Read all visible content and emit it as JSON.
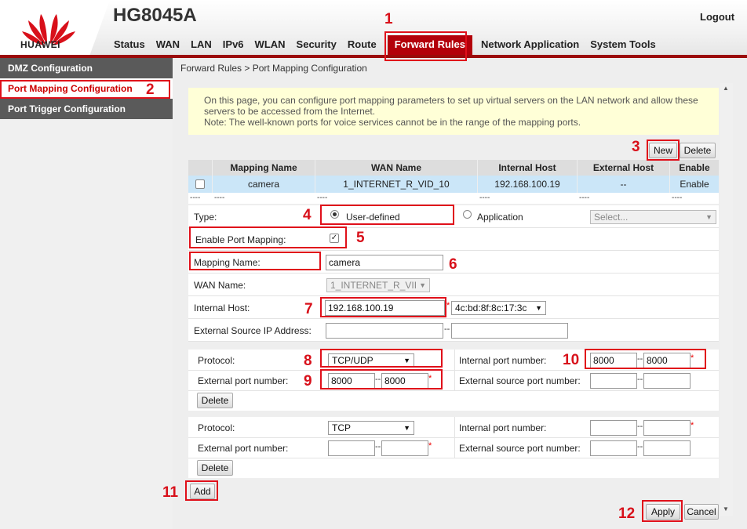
{
  "header": {
    "brand": "HUAWEI",
    "model": "HG8045A",
    "logout": "Logout",
    "nav": [
      "Status",
      "WAN",
      "LAN",
      "IPv6",
      "WLAN",
      "Security",
      "Route",
      "Forward Rules",
      "Network Application",
      "System Tools"
    ],
    "active_nav": "Forward Rules"
  },
  "sidebar": {
    "items": [
      "DMZ Configuration",
      "Port Mapping Configuration",
      "Port Trigger Configuration"
    ],
    "active": "Port Mapping Configuration"
  },
  "breadcrumb": "Forward Rules > Port Mapping Configuration",
  "notice": {
    "line1": "On this page, you can configure port mapping parameters to set up virtual servers on the LAN network and allow these servers to be accessed from the Internet.",
    "line2": "Note: The well-known ports for voice services cannot be in the range of the mapping ports."
  },
  "table_buttons": {
    "new": "New",
    "delete": "Delete"
  },
  "table": {
    "headers": [
      "Mapping Name",
      "WAN Name",
      "Internal Host",
      "External Host",
      "Enable"
    ],
    "rows": [
      [
        "camera",
        "1_INTERNET_R_VID_10",
        "192.168.100.19",
        "--",
        "Enable"
      ]
    ],
    "empty_row": [
      "----",
      "----",
      "----",
      "----",
      "----",
      "----"
    ]
  },
  "form": {
    "type_label": "Type:",
    "type_options": [
      "User-defined",
      "Application"
    ],
    "type_selected": "User-defined",
    "app_select_placeholder": "Select...",
    "enable_label": "Enable Port Mapping:",
    "enable_checked": true,
    "mapping_name_label": "Mapping Name:",
    "mapping_name_value": "camera",
    "wan_name_label": "WAN Name:",
    "wan_name_value": "1_INTERNET_R_VII",
    "internal_host_label": "Internal Host:",
    "internal_host_value": "192.168.100.19",
    "internal_host_mac": "4c:bd:8f:8c:17:3c",
    "ext_source_ip_label": "External Source IP Address:",
    "ext_source_ip_from": "",
    "ext_source_ip_to": ""
  },
  "port_blocks": [
    {
      "protocol_label": "Protocol:",
      "protocol": "TCP/UDP",
      "internal_port_label": "Internal port number:",
      "internal_port_from": "8000",
      "internal_port_to": "8000",
      "external_port_label": "External port number:",
      "external_port_from": "8000",
      "external_port_to": "8000",
      "ext_source_port_label": "External source port number:",
      "ext_source_port_from": "",
      "ext_source_port_to": "",
      "delete": "Delete"
    },
    {
      "protocol_label": "Protocol:",
      "protocol": "TCP",
      "internal_port_label": "Internal port number:",
      "internal_port_from": "",
      "internal_port_to": "",
      "external_port_label": "External port number:",
      "external_port_from": "",
      "external_port_to": "",
      "ext_source_port_label": "External source port number:",
      "ext_source_port_from": "",
      "ext_source_port_to": "",
      "delete": "Delete"
    }
  ],
  "actions": {
    "add": "Add",
    "apply": "Apply",
    "cancel": "Cancel"
  },
  "annotations": [
    "1",
    "2",
    "3",
    "4",
    "5",
    "6",
    "7",
    "8",
    "9",
    "10",
    "11",
    "12"
  ],
  "colors": {
    "brand_red": "#b3000a",
    "annotation_red": "#e0101a",
    "sidebar_gray": "#5a5a5a",
    "notice_yellow": "#ffffd7",
    "row_blue": "#cbe6f8"
  }
}
